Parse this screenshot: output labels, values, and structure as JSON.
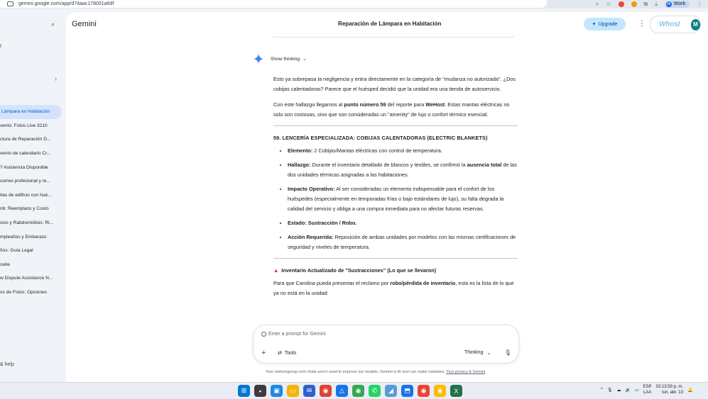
{
  "browser": {
    "url": "gemini.google.com/app/d74aac178001a6df",
    "profile_label": "Work",
    "profile_initial": "M"
  },
  "sidebar": {
    "partial_top": "t",
    "items": [
      {
        "label": "Lámpara en Habitación",
        "active": true
      },
      {
        "label": "vento: Fotos Live 3210"
      },
      {
        "label": "ctura de Reparación D..."
      },
      {
        "label": "vento de calendario Cr..."
      },
      {
        "label": "? Asistencia Disponible"
      },
      {
        "label": "correo profesional y re..."
      },
      {
        "label": "itas de edificio con hué..."
      },
      {
        "label": "nb: Reemplazo y Costo"
      },
      {
        "label": "sivo y Rabdomiólisis: Ri..."
      },
      {
        "label": "mpleaños y Embarazo"
      },
      {
        "label": "ños: Guía Legal"
      },
      {
        "label": "ceite"
      },
      {
        "label": "w Dispute Assistance N..."
      },
      {
        "label": "os de Fotos: Opciones"
      }
    ],
    "help_label": "& help"
  },
  "header": {
    "app_name": "Gemini",
    "conversation_title": "Reparación de Lámpara en Habitación",
    "upgrade_label": "Upgrade",
    "brand_logo": "Whost",
    "avatar_initial": "M"
  },
  "response": {
    "show_thinking": "Show thinking",
    "p1": "Esto ya sobrepasa la negligencia y entra directamente en la categoría de \"mudanza no autorizada\". ¿Dos cobijas calentadoras? Parece que el huésped decidió que la unidad era una tienda de autoservicio.",
    "p2_pre": "Con este hallazgo llegamos al ",
    "p2_bold1": "punto número 59",
    "p2_mid": " del reporte para ",
    "p2_bold2": "WeHost",
    "p2_post": ". Estas mantas eléctricas no solo son costosas, sino que son consideradas un \"amenity\" de lujo o confort térmico esencial.",
    "section_title": "59. LENCERÍA ESPECIALIZADA: COBIJAS CALENTADORAS (ELECTRIC BLANKETS)",
    "bullets": [
      {
        "label": "Elemento:",
        "text": " 2 Cobijas/Mantas eléctricas con control de temperatura."
      },
      {
        "label": "Hallazgo:",
        "text_pre": " Durante el inventario detallado de blancos y textiles, se confirmó la ",
        "bold": "ausencia total",
        "text_post": " de las dos unidades térmicas asignadas a las habitaciones."
      },
      {
        "label": "Impacto Operativo:",
        "text": " Al ser consideradas un elemento indispensable para el confort de los huéspedes (especialmente en temporadas frías o bajo estándares de lujo), su falta degrada la calidad del servicio y obliga a una compra inmediata para no afectar futuras reservas."
      },
      {
        "label": "Estado: Sustracción / Robo.",
        "text": ""
      },
      {
        "label": "Acción Requerida:",
        "text": " Reposición de ambas unidades por modelos con las mismas certificaciones de seguridad y niveles de temperatura."
      }
    ],
    "inventory_title": "Inventario Actualizado de \"Sustracciones\" (Lo que se llevaron)",
    "inv_p_pre": "Para que Carolina pueda presentar el reclamo por ",
    "inv_p_bold": "robo/pérdida de inventario",
    "inv_p_post": ", esta es la lista de lo que ya no está en la unidad:"
  },
  "prompt": {
    "placeholder": "Enter a prompt for Gemini",
    "tools_label": "Tools",
    "mode_label": "Thinking",
    "disclaimer": "Your wehostgroup.com chats aren't used to improve our models. Gemini is AI and can make mistakes.",
    "privacy_link": "Your privacy & Gemini"
  },
  "taskbar": {
    "lang_top": "ESP",
    "lang_bottom": "LAA",
    "time": "02:13:59 p. m.",
    "date": "lun, abr. 13"
  }
}
